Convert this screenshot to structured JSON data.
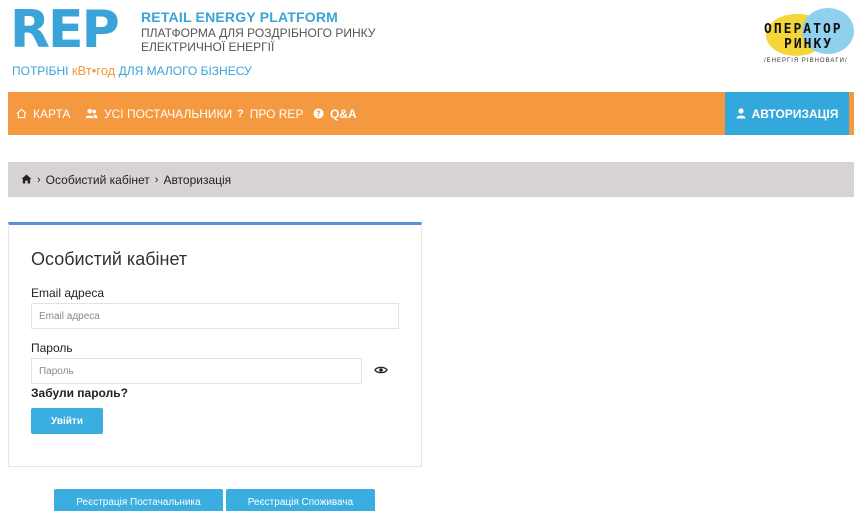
{
  "header": {
    "logo_text": "REP",
    "title": "RETAIL ENERGY PLATFORM",
    "subtitle_line1": "ПЛАТФОРМА ДЛЯ РОЗДРІБНОГО РИНКУ",
    "subtitle_line2": "ЕЛЕКТРИЧНОЇ ЕНЕРГІЇ",
    "tagline_pre": "ПОТРІБНІ ",
    "tagline_unit": "кВт•год",
    "tagline_post": " ДЛЯ МАЛОГО БІЗНЕСУ",
    "operator_line1": "ОПЕРАТОР",
    "operator_line2": "РИНКУ",
    "operator_line3": "/ЕНЕРГІЯ РІВНОВАГИ/"
  },
  "nav": {
    "items": [
      {
        "label": "КАРТА",
        "icon": "home-outline-icon"
      },
      {
        "label": "УСІ ПОСТАЧАЛЬНИКИ",
        "icon": "users-icon"
      },
      {
        "label": "ПРО REP",
        "icon": "question-icon"
      },
      {
        "label": "Q&A",
        "icon": "question-circle-icon"
      }
    ],
    "auth_label": "АВТОРИЗАЦІЯ"
  },
  "breadcrumb": {
    "items": [
      "Особистий кабінет",
      "Авторизація"
    ]
  },
  "login": {
    "title": "Особистий кабінет",
    "email_label": "Email адреса",
    "email_placeholder": "Email адреса",
    "email_value": "",
    "password_label": "Пароль",
    "password_placeholder": "Пароль",
    "password_value": "",
    "forgot_label": "Забули пароль?",
    "submit_label": "Увійти"
  },
  "register": {
    "supplier_label": "Реєстрація Постачальника",
    "consumer_label": "Реєстрація Споживача"
  },
  "colors": {
    "brand_blue": "#3aa3d8",
    "nav_orange": "#f4993f",
    "auth_blue": "#33a8dc",
    "breadcrumb_gray": "#d8d3d3",
    "card_accent": "#5b8fd9"
  }
}
